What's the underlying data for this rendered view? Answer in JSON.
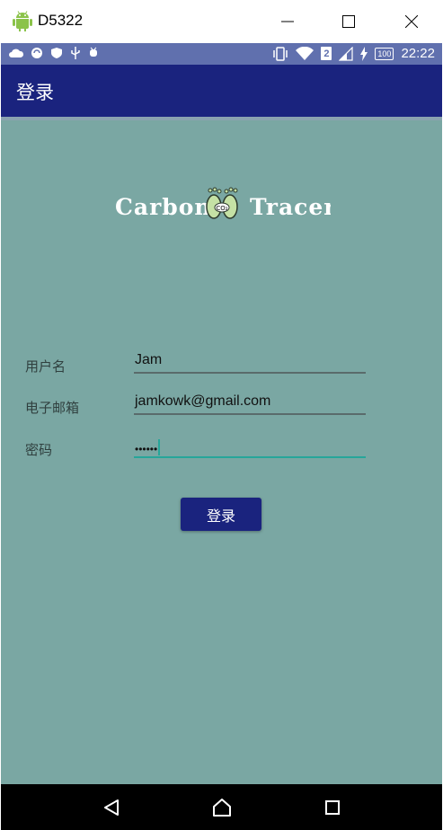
{
  "window": {
    "title": "D5322"
  },
  "status_bar": {
    "time": "22:22",
    "battery": "100",
    "sim": "2"
  },
  "app_bar": {
    "title": "登录"
  },
  "logo": {
    "text_left": "Carbon",
    "text_right": "Tracer",
    "badge": "CO₂"
  },
  "form": {
    "username": {
      "label": "用户名",
      "value": "Jam"
    },
    "email": {
      "label": "电子邮箱",
      "value": "jamkowk@gmail.com"
    },
    "password": {
      "label": "密码",
      "value": "••••••"
    }
  },
  "login_button": {
    "label": "登录"
  },
  "colors": {
    "status_bar": "#6070ae",
    "app_bar": "#1a237e",
    "background": "#7aa7a3",
    "focus": "#26a69a"
  },
  "icons": [
    "android-icon",
    "minimize-icon",
    "maximize-icon",
    "close-icon",
    "cloud-icon",
    "sync-icon",
    "shield-icon",
    "usb-icon",
    "debug-icon",
    "vibrate-icon",
    "wifi-icon",
    "sim-icon",
    "signal-icon",
    "charging-icon",
    "battery-icon",
    "back-icon",
    "home-icon",
    "recents-icon"
  ]
}
